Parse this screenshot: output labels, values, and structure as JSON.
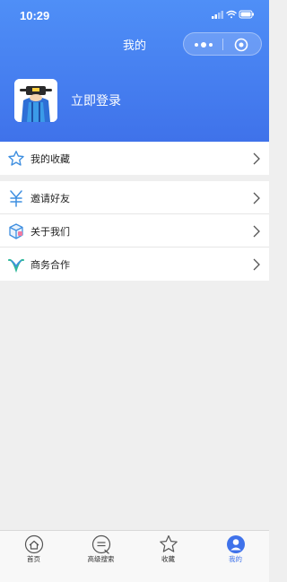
{
  "status_bar": {
    "time": "10:29"
  },
  "header": {
    "title": "我的",
    "profile": {
      "login_label": "立即登录"
    }
  },
  "menu_group_1": [
    {
      "label": "我的收藏",
      "icon": "star-icon"
    }
  ],
  "menu_group_2": [
    {
      "label": "邀请好友",
      "icon": "yuan-icon"
    },
    {
      "label": "关于我们",
      "icon": "box-icon"
    },
    {
      "label": "商务合作",
      "icon": "handshake-icon"
    }
  ],
  "tabbar": [
    {
      "label": "首页",
      "icon": "home-icon",
      "active": false
    },
    {
      "label": "高级搜索",
      "icon": "search-icon",
      "active": false
    },
    {
      "label": "收藏",
      "icon": "star-icon",
      "active": false
    },
    {
      "label": "我的",
      "icon": "person-icon",
      "active": true
    }
  ],
  "colors": {
    "header_top": "#4f8ff7",
    "header_bottom": "#3f72ea",
    "accent": "#3f72ea",
    "background": "#efefef"
  }
}
